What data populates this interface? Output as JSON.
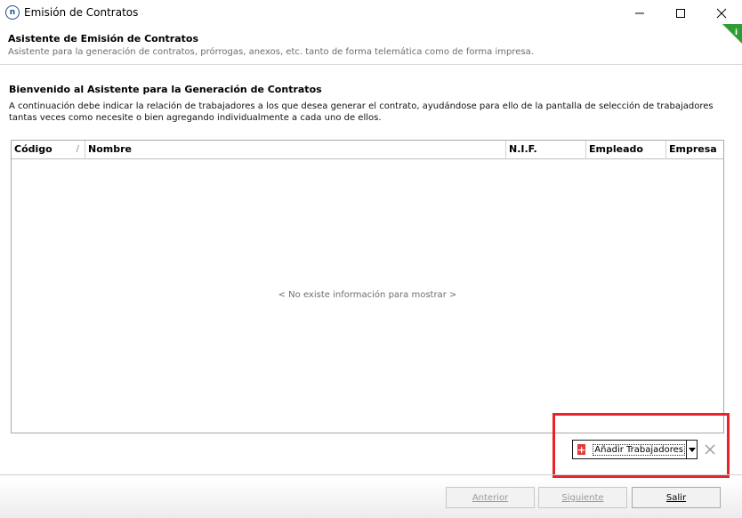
{
  "window": {
    "title": "Emisión de Contratos",
    "app_icon_letter": "n",
    "controls": [
      "minimize",
      "maximize",
      "close"
    ]
  },
  "header": {
    "title": "Asistente de Emisión de Contratos",
    "subtitle": "Asistente para la generación de contratos, prórrogas, anexos, etc.  tanto de forma telemática como de forma impresa.",
    "info_icon": "i"
  },
  "welcome": {
    "title": "Bienvenido al Asistente para la Generación de Contratos",
    "text": "A continuación debe indicar la relación de trabajadores a los que desea generar el contrato, ayudándose para ello de la pantalla de selección de trabajadores tantas veces como necesite o bien agregando individualmente a cada uno de ellos."
  },
  "grid": {
    "columns": [
      "Código",
      "Nombre",
      "N.I.F.",
      "Empleado",
      "Empresa"
    ],
    "sort_indicator": "/",
    "empty_message": "< No existe información para mostrar >",
    "rows": []
  },
  "actions": {
    "add_workers_label": "Añadir Trabajadores",
    "add_icon": "plus-icon",
    "remove_icon": "close-icon"
  },
  "footer": {
    "previous_label": "Anterior",
    "next_label": "Siguiente",
    "exit_label": "Salir"
  },
  "colors": {
    "highlight": "#e8232a",
    "info_flag": "#2e9e34",
    "add_icon_bg": "#e23b3b"
  }
}
